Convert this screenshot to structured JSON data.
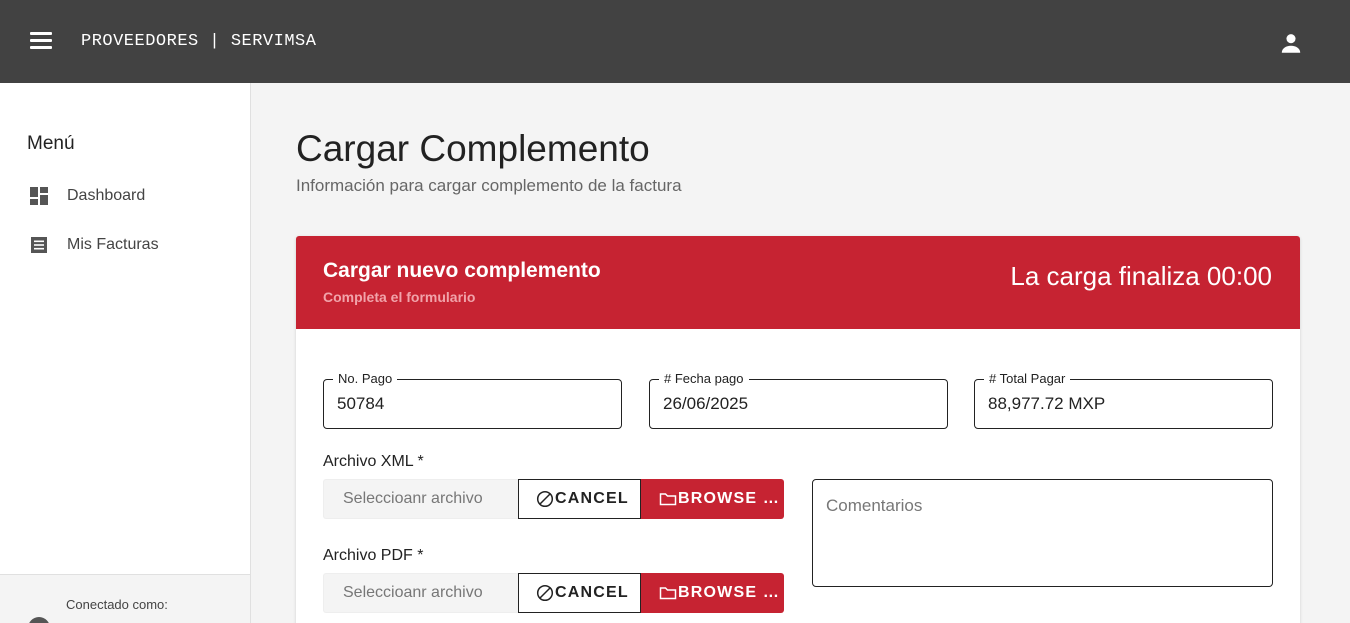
{
  "header": {
    "title": "PROVEEDORES | SERVIMSA",
    "menu_icon": "hamburger-menu-icon",
    "user_icon": "account-icon"
  },
  "sidebar": {
    "title": "Menú",
    "items": [
      {
        "label": "Dashboard",
        "icon": "dashboard-icon"
      },
      {
        "label": "Mis Facturas",
        "icon": "receipt-icon"
      }
    ],
    "footer": {
      "label": "Conectado como:"
    }
  },
  "page": {
    "title": "Cargar Complemento",
    "subtitle": "Información para cargar complemento de la factura"
  },
  "card": {
    "title": "Cargar nuevo complemento",
    "subtitle": "Completa el formulario",
    "timer": "La carga finaliza 00:00",
    "fields": [
      {
        "label": "No. Pago",
        "value": "50784"
      },
      {
        "label": "# Fecha pago",
        "value": "26/06/2025"
      },
      {
        "label": "# Total Pagar",
        "value": "88,977.72 MXP"
      }
    ],
    "xml": {
      "label": "Archivo XML *",
      "placeholder": "Seleccioanr archivo",
      "cancel": "CANCEL",
      "browse": "BROWSE …"
    },
    "pdf": {
      "label": "Archivo PDF *",
      "placeholder": "Seleccioanr archivo",
      "cancel": "CANCEL",
      "browse": "BROWSE …"
    },
    "comments_placeholder": "Comentarios"
  },
  "colors": {
    "topbar": "#424242",
    "accent": "#c62332",
    "background": "#f4f4f4"
  }
}
